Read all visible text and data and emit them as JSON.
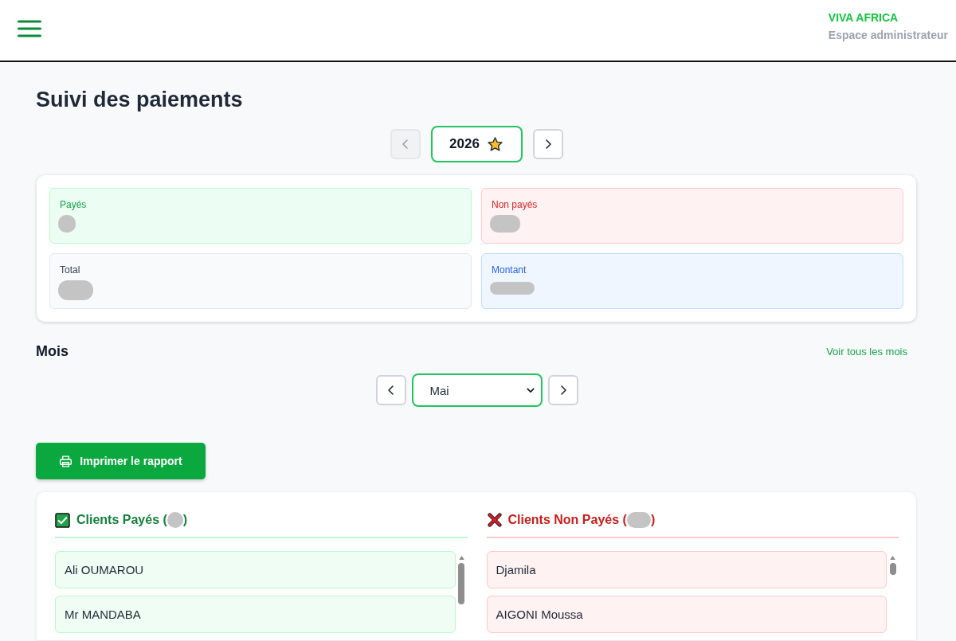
{
  "header": {
    "brand": "VIVA AFRICA",
    "subtitle": "Espace administrateur"
  },
  "page_title": "Suivi des paiements",
  "year_nav": {
    "prev_disabled": true,
    "year": "2026",
    "current": true,
    "next_disabled": false
  },
  "stats": [
    {
      "kind": "paid",
      "label": "Payés",
      "value_redacted": true
    },
    {
      "kind": "unpaid",
      "label": "Non payés",
      "value_redacted": true
    },
    {
      "kind": "total",
      "label": "Total",
      "value_redacted": true
    },
    {
      "kind": "amount",
      "label": "Montant",
      "value_redacted": true
    }
  ],
  "months": {
    "title": "Mois",
    "link": "Voir tous les mois",
    "selected_month": "Mai"
  },
  "print_button": "Imprimer le rapport",
  "client_lists": [
    {
      "kind": "paid",
      "title": "Clients Payés (",
      "title_end": ")",
      "count_redacted": true,
      "clients": [
        "Ali OUMAROU",
        "Mr MANDABA"
      ]
    },
    {
      "kind": "unpaid",
      "title": "Clients Non Payés (",
      "title_end": ")",
      "count_redacted": true,
      "clients": [
        "Djamila",
        "AIGONI Moussa"
      ]
    }
  ]
}
